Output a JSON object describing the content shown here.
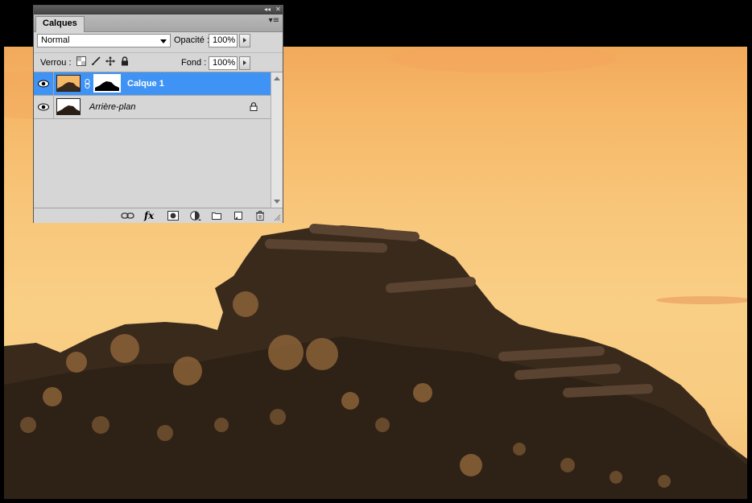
{
  "panel": {
    "tab_label": "Calques",
    "collapse_glyph": "◂◂",
    "close_glyph": "✕",
    "menu_glyph": "▾≡",
    "blend_mode": "Normal",
    "opacity_label": "Opacité :",
    "opacity_value": "100%",
    "lock_label": "Verrou :",
    "fill_label": "Fond :",
    "fill_value": "100%",
    "layers": [
      {
        "name": "Calque 1",
        "selected": true,
        "visible": true,
        "has_mask": true,
        "locked": false
      },
      {
        "name": "Arrière-plan",
        "selected": false,
        "visible": true,
        "has_mask": false,
        "locked": true
      }
    ],
    "bottom_icons": [
      "link-layers-icon",
      "fx-icon",
      "add-mask-icon",
      "adjustment-layer-icon",
      "new-group-icon",
      "new-layer-icon",
      "delete-layer-icon"
    ],
    "fx_text": "fx"
  },
  "colors": {
    "selection": "#3f93f5",
    "sky_top": "#f2a95a",
    "sky_bottom": "#f3bd72",
    "wood_dark": "#3a2a1c"
  }
}
